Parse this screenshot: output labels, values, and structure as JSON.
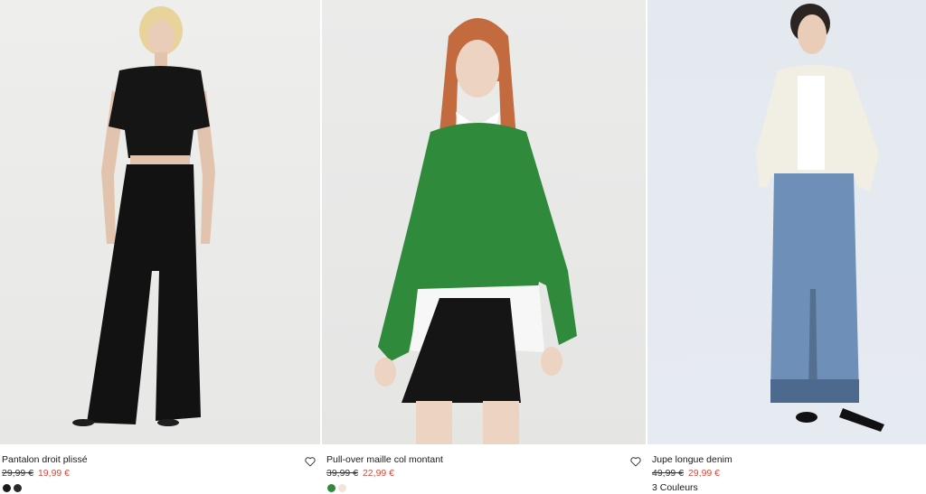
{
  "products": [
    {
      "name": "Pantalon droit plissé",
      "old_price": "29,99 €",
      "new_price": "19,99 €",
      "swatches": [
        "#1b1b1b",
        "#2a2a2a"
      ],
      "colors_label": ""
    },
    {
      "name": "Pull-over maille col montant",
      "old_price": "39,99 €",
      "new_price": "22,99 €",
      "swatches": [
        "#2f8a3b",
        "#efe6d6"
      ],
      "colors_label": ""
    },
    {
      "name": "Jupe longue denim",
      "old_price": "49,99 €",
      "new_price": "29,99 €",
      "swatches": [],
      "colors_label": "3 Couleurs"
    }
  ],
  "colors": {
    "sale_price": "#d14b3c",
    "text": "#1a1a1a"
  },
  "icons": {
    "wishlist": "heart-outline-icon"
  }
}
